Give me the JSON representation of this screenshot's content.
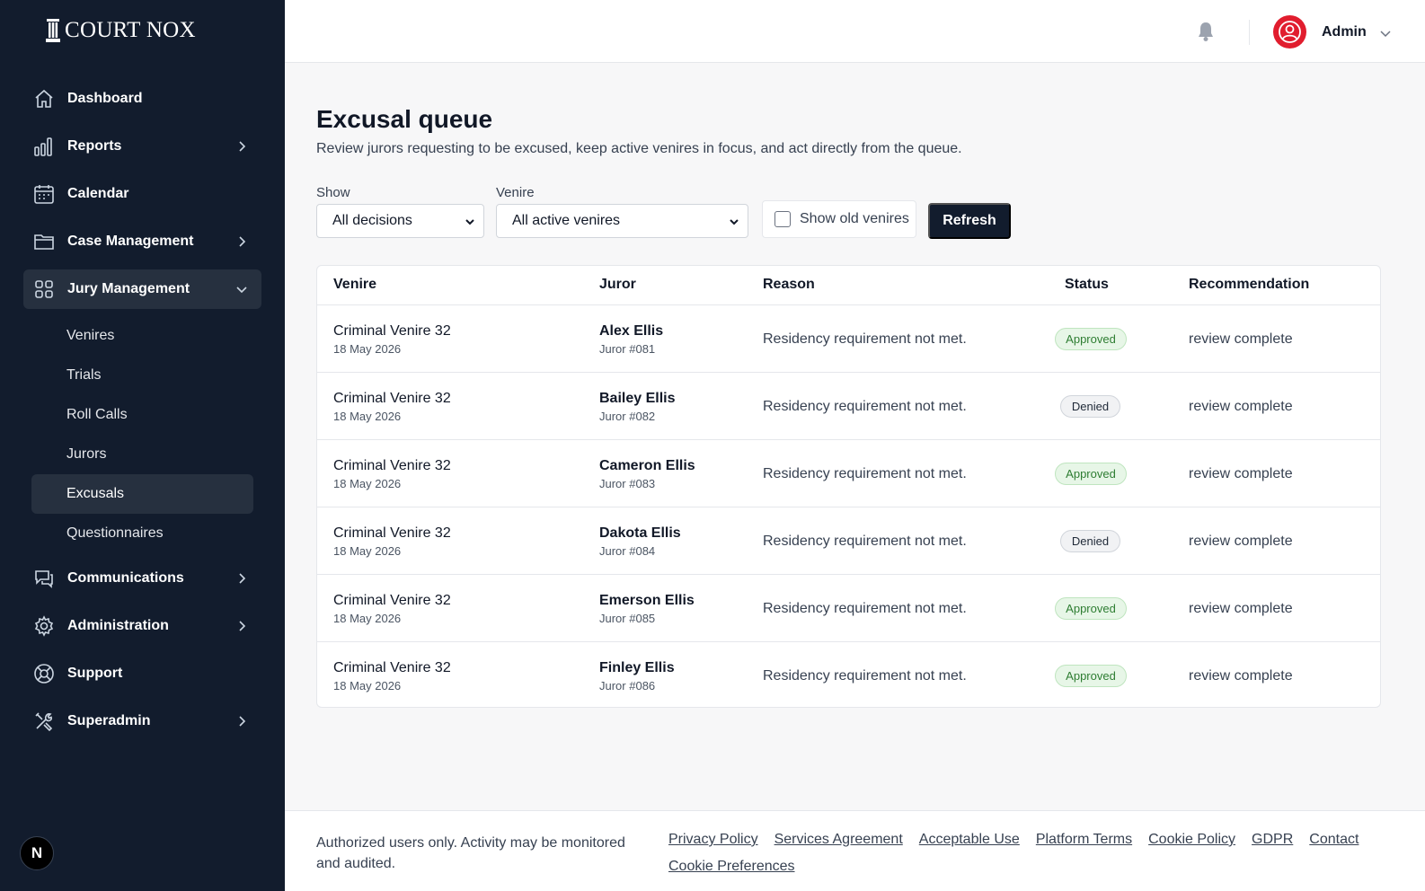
{
  "brand": {
    "name": "COURT NOX"
  },
  "sidebar": {
    "items": [
      {
        "label": "Dashboard",
        "icon": "home-icon"
      },
      {
        "label": "Reports",
        "icon": "bar-chart-icon"
      },
      {
        "label": "Calendar",
        "icon": "calendar-icon"
      },
      {
        "label": "Case Management",
        "icon": "folder-icon"
      },
      {
        "label": "Jury Management",
        "icon": "grid-icon"
      },
      {
        "label": "Communications",
        "icon": "chat-icon"
      },
      {
        "label": "Administration",
        "icon": "gear-icon"
      },
      {
        "label": "Support",
        "icon": "lifebuoy-icon"
      },
      {
        "label": "Superadmin",
        "icon": "tools-icon"
      }
    ],
    "jury_subitems": [
      "Venires",
      "Trials",
      "Roll Calls",
      "Jurors",
      "Excusals",
      "Questionnaires"
    ],
    "active_subitem": "Excusals",
    "bottom_avatar": "N"
  },
  "header": {
    "user_name": "Admin"
  },
  "main": {
    "title": "Excusal queue",
    "subtitle": "Review jurors requesting to be excused, keep active venires in focus, and act directly from the queue.",
    "filters": {
      "show_label": "Show",
      "show_value": "All decisions",
      "venire_label": "Venire",
      "venire_value": "All active venires",
      "old_venires_label": "Show old venires",
      "old_venires_checked": false,
      "refresh_label": "Refresh"
    },
    "table": {
      "headers": [
        "Venire",
        "Juror",
        "Reason",
        "Status",
        "Recommendation"
      ],
      "rows": [
        {
          "venire": "Criminal Venire 32",
          "date": "18 May 2026",
          "juror": "Alex Ellis",
          "juror_no": "Juror #081",
          "reason": "Residency requirement not met.",
          "status": "Approved",
          "recommendation": "review complete"
        },
        {
          "venire": "Criminal Venire 32",
          "date": "18 May 2026",
          "juror": "Bailey Ellis",
          "juror_no": "Juror #082",
          "reason": "Residency requirement not met.",
          "status": "Denied",
          "recommendation": "review complete"
        },
        {
          "venire": "Criminal Venire 32",
          "date": "18 May 2026",
          "juror": "Cameron Ellis",
          "juror_no": "Juror #083",
          "reason": "Residency requirement not met.",
          "status": "Approved",
          "recommendation": "review complete"
        },
        {
          "venire": "Criminal Venire 32",
          "date": "18 May 2026",
          "juror": "Dakota Ellis",
          "juror_no": "Juror #084",
          "reason": "Residency requirement not met.",
          "status": "Denied",
          "recommendation": "review complete"
        },
        {
          "venire": "Criminal Venire 32",
          "date": "18 May 2026",
          "juror": "Emerson Ellis",
          "juror_no": "Juror #085",
          "reason": "Residency requirement not met.",
          "status": "Approved",
          "recommendation": "review complete"
        },
        {
          "venire": "Criminal Venire 32",
          "date": "18 May 2026",
          "juror": "Finley Ellis",
          "juror_no": "Juror #086",
          "reason": "Residency requirement not met.",
          "status": "Approved",
          "recommendation": "review complete"
        }
      ]
    }
  },
  "footer": {
    "note": "Authorized users only. Activity may be monitored and audited.",
    "links": [
      "Privacy Policy",
      "Services Agreement",
      "Acceptable Use",
      "Platform Terms",
      "Cookie Policy",
      "GDPR",
      "Contact",
      "Cookie Preferences"
    ]
  },
  "colors": {
    "sidebar_bg": "#121c2d",
    "accent_red": "#e11d2e",
    "approved_green": "#2e7d32"
  }
}
